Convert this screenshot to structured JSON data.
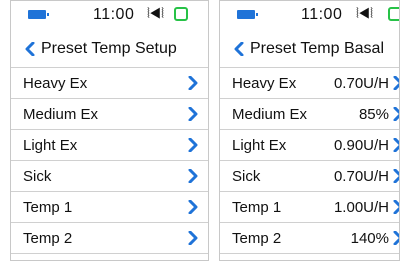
{
  "colors": {
    "accent": "#1f73d8",
    "status_green": "#27c247",
    "divider": "#d0d0d0"
  },
  "left_screen": {
    "status": {
      "time": "11:00",
      "vibrate_icon": "vibrate-icon",
      "battery_icon": "battery-icon"
    },
    "header": {
      "title": "Preset Temp Setup",
      "back_icon": "chevron-left-icon"
    },
    "items": [
      {
        "label": "Heavy Ex"
      },
      {
        "label": "Medium Ex"
      },
      {
        "label": "Light Ex"
      },
      {
        "label": "Sick"
      },
      {
        "label": "Temp 1"
      },
      {
        "label": "Temp 2"
      }
    ]
  },
  "right_screen": {
    "status": {
      "time": "11:00",
      "vibrate_icon": "vibrate-icon",
      "battery_icon": "battery-icon"
    },
    "header": {
      "title": "Preset Temp Basal",
      "back_icon": "chevron-left-icon"
    },
    "items": [
      {
        "label": "Heavy Ex",
        "value": "0.70U/H"
      },
      {
        "label": "Medium Ex",
        "value": "85%"
      },
      {
        "label": "Light Ex",
        "value": "0.90U/H"
      },
      {
        "label": "Sick",
        "value": "0.70U/H"
      },
      {
        "label": "Temp 1",
        "value": "1.00U/H"
      },
      {
        "label": "Temp 2",
        "value": "140%"
      }
    ]
  }
}
